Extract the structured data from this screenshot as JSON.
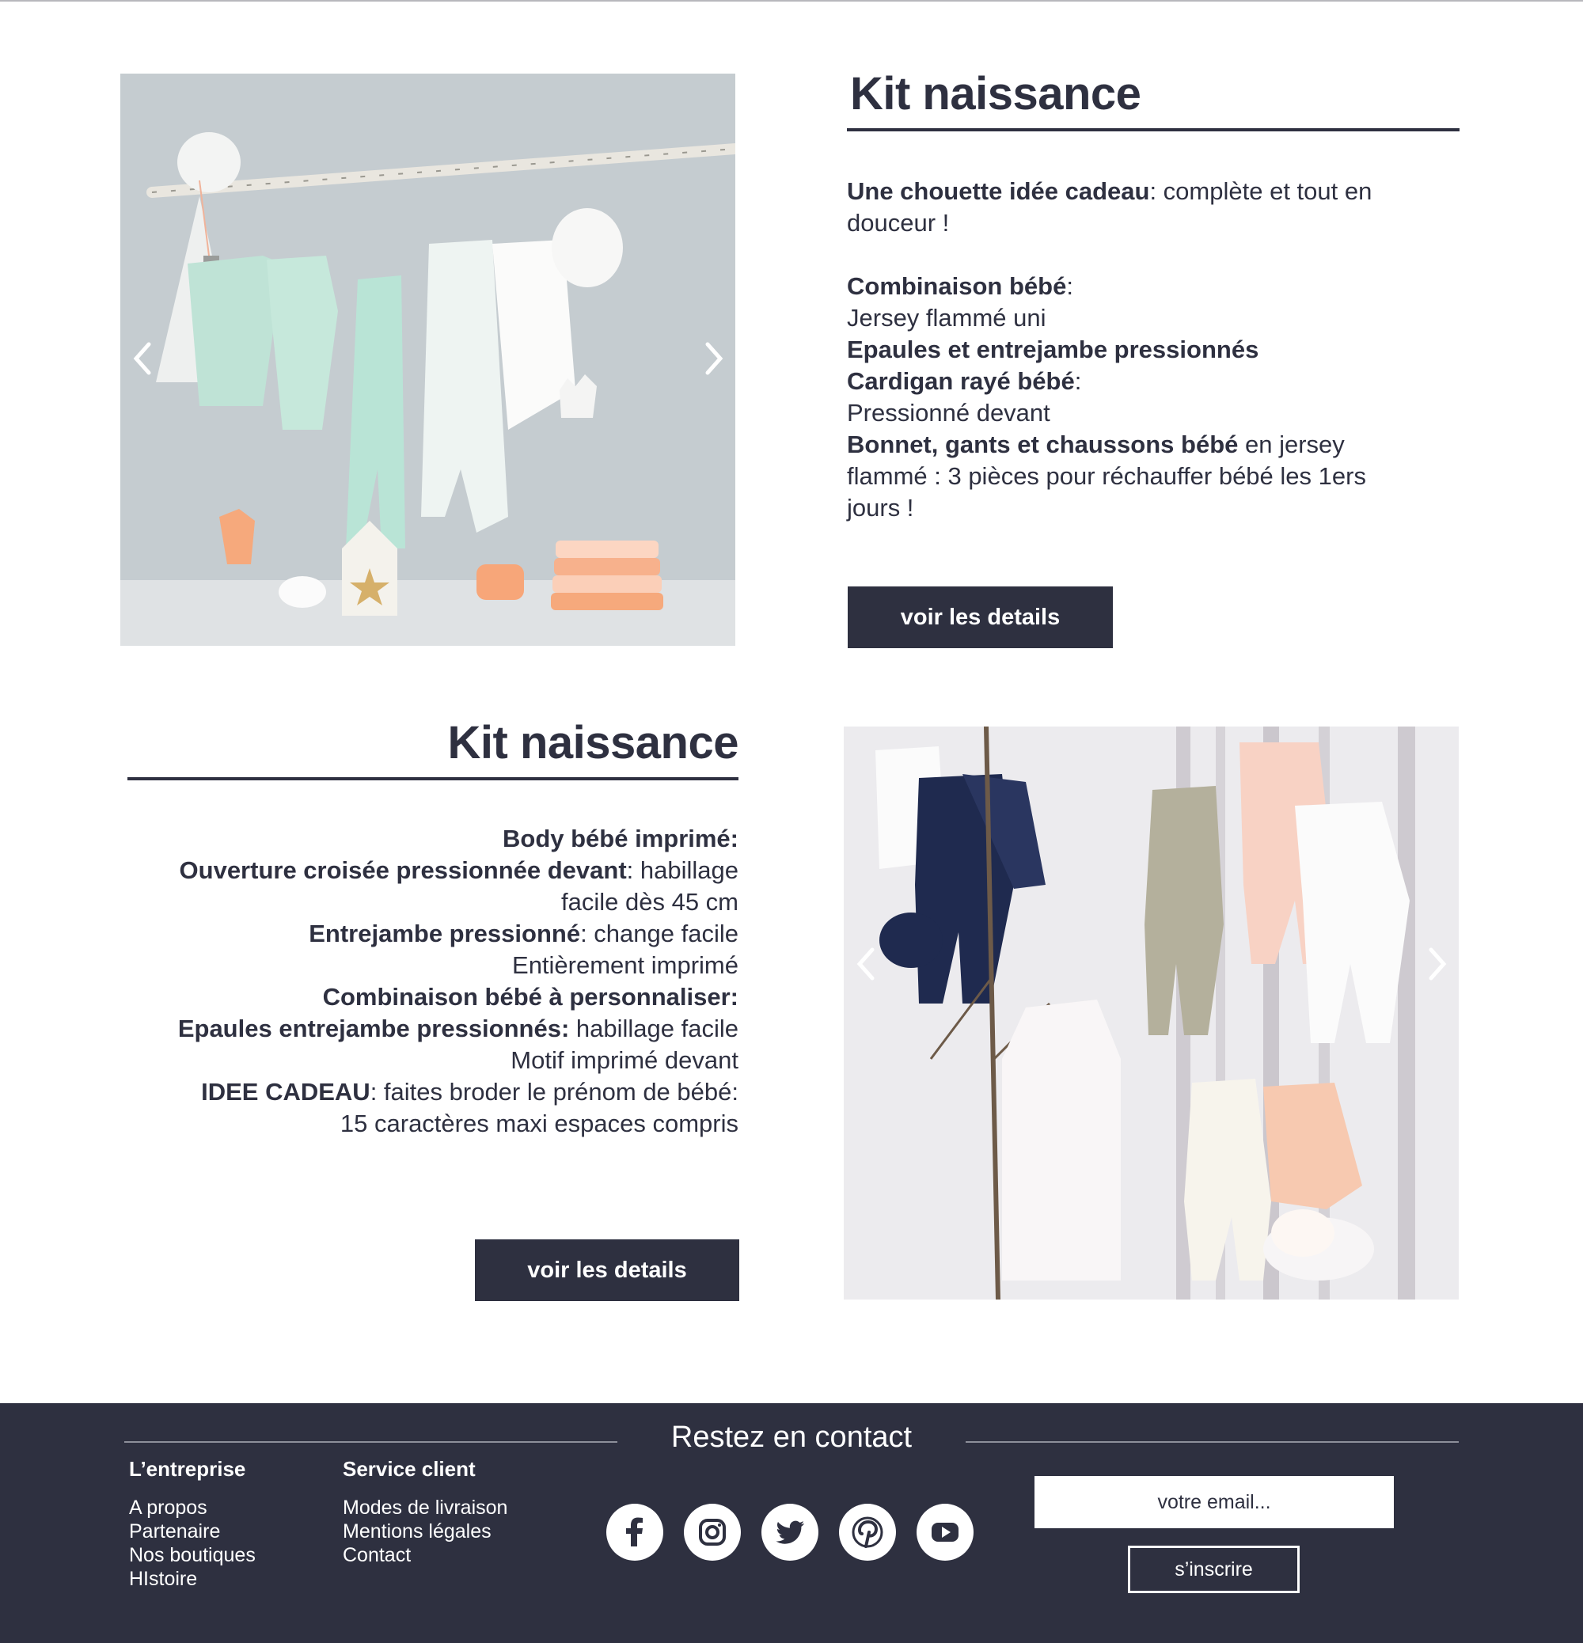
{
  "products": [
    {
      "title": "Kit naissance",
      "image_alt": "Kit naissance - vêtements bébé suspendus sur une branche",
      "description": [
        [
          {
            "b": "Une chouette idée cadeau"
          },
          {
            "t": ": complète et tout en"
          }
        ],
        [
          {
            "t": "douceur !"
          }
        ],
        [],
        [
          {
            "b": "Combinaison bébé"
          },
          {
            "t": ":"
          }
        ],
        [
          {
            "t": "Jersey flammé uni"
          }
        ],
        [
          {
            "b": "Epaules et entrejambe pressionnés"
          }
        ],
        [
          {
            "b": "Cardigan rayé bébé"
          },
          {
            "t": ":"
          }
        ],
        [
          {
            "t": "Pressionné devant"
          }
        ],
        [
          {
            "b": "Bonnet, gants et chaussons bébé"
          },
          {
            "t": " en jersey"
          }
        ],
        [
          {
            "t": "flammé : 3 pièces pour réchauffer bébé les 1ers"
          }
        ],
        [
          {
            "t": "jours !"
          }
        ]
      ],
      "button_label": "voir les details"
    },
    {
      "title": "Kit naissance",
      "image_alt": "Kit naissance - pyjamas et gigoteuse bébé",
      "description": [
        [
          {
            "b": "Body bébé imprimé:"
          }
        ],
        [
          {
            "b": "Ouverture croisée pressionnée devant"
          },
          {
            "t": ": habillage"
          }
        ],
        [
          {
            "t": "facile dès 45 cm"
          }
        ],
        [
          {
            "b": "Entrejambe pressionné"
          },
          {
            "t": ": change facile"
          }
        ],
        [
          {
            "t": "Entièrement imprimé"
          }
        ],
        [
          {
            "b": "Combinaison bébé à personnaliser:"
          }
        ],
        [
          {
            "b": "Epaules entrejambe pressionnés:"
          },
          {
            "t": " habillage facile"
          }
        ],
        [
          {
            "t": "Motif imprimé devant"
          }
        ],
        [
          {
            "b": "IDEE CADEAU"
          },
          {
            "t": ": faites broder le prénom de bébé:"
          }
        ],
        [
          {
            "t": "15 caractères maxi espaces compris"
          }
        ]
      ],
      "button_label": "voir les details"
    }
  ],
  "footer": {
    "contact_title": "Restez en contact",
    "columns": [
      {
        "title": "L’entreprise",
        "links": [
          "A propos",
          "Partenaire",
          "Nos boutiques",
          "HIstoire"
        ]
      },
      {
        "title": "Service client",
        "links": [
          "Modes de livraison",
          "Mentions légales",
          "Contact"
        ]
      }
    ],
    "socials": [
      "facebook-icon",
      "instagram-icon",
      "twitter-icon",
      "pinterest-icon",
      "youtube-icon"
    ],
    "email_placeholder": "votre email...",
    "subscribe_label": "s’inscrire"
  },
  "colors": {
    "navy": "#2e3040",
    "white": "#ffffff",
    "mint": "#bfe3d6",
    "peach": "#f6a97c"
  }
}
